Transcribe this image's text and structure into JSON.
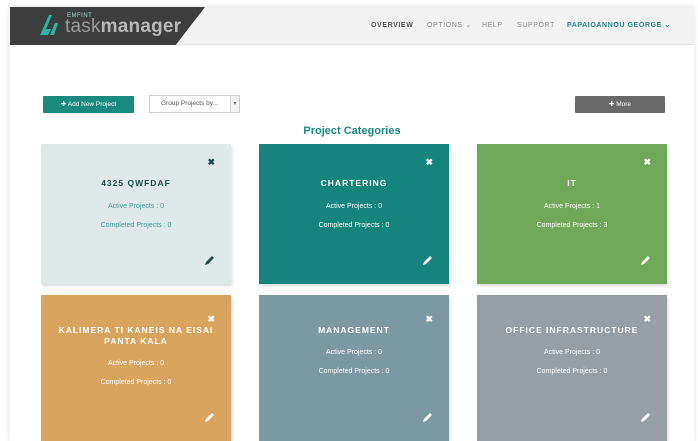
{
  "header": {
    "logo_small": "EMFINT",
    "logo_task": "task",
    "logo_manager": "manager",
    "nav": {
      "overview": "OVERVIEW",
      "options": "OPTIONS ⌄",
      "help": "HELP",
      "support": "SUPPORT",
      "user": "PAPAIOANNOU GEORGE ⌄"
    }
  },
  "toolbar": {
    "add_project": "✚ Add New Project",
    "group_by": "Group Projects by...",
    "more": "✚ More"
  },
  "section_title": "Project Categories",
  "colors": {
    "accent": "#1a8a80",
    "card_light": "#dfe9ea",
    "card_teal": "#14847c",
    "card_green": "#6fa858",
    "card_orange": "#d9a45d",
    "card_slate": "#7c98a1",
    "card_gray": "#969fa6"
  },
  "cards": [
    {
      "name": "4325 QWFDAF",
      "active": "Active Projects : 0",
      "completed": "Completed Projects : 0",
      "close": "✖"
    },
    {
      "name": "CHARTERING",
      "active": "Active Projects : 0",
      "completed": "Completed Projects : 0",
      "close": "✖"
    },
    {
      "name": "IT",
      "active": "Active Projects : 1",
      "completed": "Completed Projects : 3",
      "close": "✖"
    },
    {
      "name": "KALIMERA TI KANEIS NA EISAI PANTA KALA",
      "active": "Active Projects : 0",
      "completed": "Completed Projects : 0",
      "close": "✖"
    },
    {
      "name": "MANAGEMENT",
      "active": "Active Projects : 0",
      "completed": "Completed Projects : 0",
      "close": "✖"
    },
    {
      "name": "OFFICE INFRASTRUCTURE",
      "active": "Active Projects : 0",
      "completed": "Completed Projects : 0",
      "close": "✖"
    }
  ],
  "icons": {
    "logo": "bolt-logo-icon",
    "close": "close-icon",
    "edit": "pencil-icon"
  }
}
